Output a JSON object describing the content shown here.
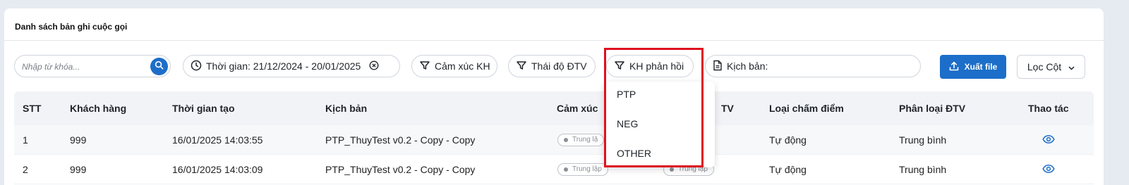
{
  "card": {
    "title": "Danh sách bản ghi cuộc gọi"
  },
  "search": {
    "placeholder": "Nhập từ khóa..."
  },
  "filters": {
    "time": "Thời gian: 21/12/2024 - 20/01/2025",
    "emotion": "Cảm xúc KH",
    "attitude": "Thái độ ĐTV",
    "feedback": "KH phản hồi",
    "script": "Kịch bản:"
  },
  "toolbar": {
    "export_label": "Xuất file",
    "column_filter_label": "Lọc Cột"
  },
  "table": {
    "headers": [
      "STT",
      "Khách hàng",
      "Thời gian tạo",
      "Kịch bản",
      "Cảm xúc",
      "Thái độ ĐTV",
      "Loại chấm điểm",
      "Phân loại ĐTV",
      "Thao tác"
    ],
    "header_visible": {
      "emotion": "Cảm xúc",
      "attitude": "TV"
    },
    "rows": [
      {
        "stt": "1",
        "customer": "999",
        "created": "16/01/2025 14:03:55",
        "script": "PTP_ThuyTest v0.2 - Copy - Copy",
        "emotion": "Trung lậ",
        "attitude": "",
        "scoring": "Tự động",
        "classification": "Trung bình"
      },
      {
        "stt": "2",
        "customer": "999",
        "created": "16/01/2025 14:03:09",
        "script": "PTP_ThuyTest v0.2 - Copy - Copy",
        "emotion": "Trung lập",
        "attitude": "Trung lập",
        "scoring": "Tự động",
        "classification": "Trung bình"
      }
    ]
  },
  "dropdown": {
    "options": [
      "PTP",
      "NEG",
      "OTHER"
    ]
  },
  "colors": {
    "primary": "#1c6ec9",
    "highlight": "#e0101f",
    "header_bg": "#f1f3f6"
  }
}
